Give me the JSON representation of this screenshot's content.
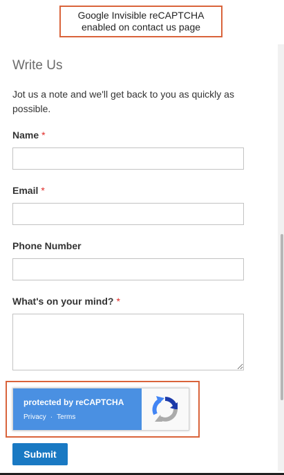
{
  "annotation": {
    "top_line1": "Google Invisible reCAPTCHA",
    "top_line2": "enabled on contact us page"
  },
  "form": {
    "title": "Write Us",
    "intro": "Jot us a note and we'll get back to you as quickly as possible.",
    "required_marker": "*",
    "fields": {
      "name": {
        "label": "Name",
        "value": "",
        "required": true
      },
      "email": {
        "label": "Email",
        "value": "",
        "required": true
      },
      "phone": {
        "label": "Phone Number",
        "value": "",
        "required": false
      },
      "message": {
        "label": "What's on your mind?",
        "value": "",
        "required": true
      }
    },
    "submit_label": "Submit"
  },
  "recaptcha": {
    "protected_prefix": "protected by ",
    "brand": "reCAPTCHA",
    "privacy_label": "Privacy",
    "separator": "·",
    "terms_label": "Terms",
    "icon": "recaptcha-logo-icon"
  },
  "colors": {
    "accent": "#d9633a",
    "primary_button": "#1979c3",
    "recaptcha_blue": "#4a90e2",
    "required": "#e02b27"
  }
}
